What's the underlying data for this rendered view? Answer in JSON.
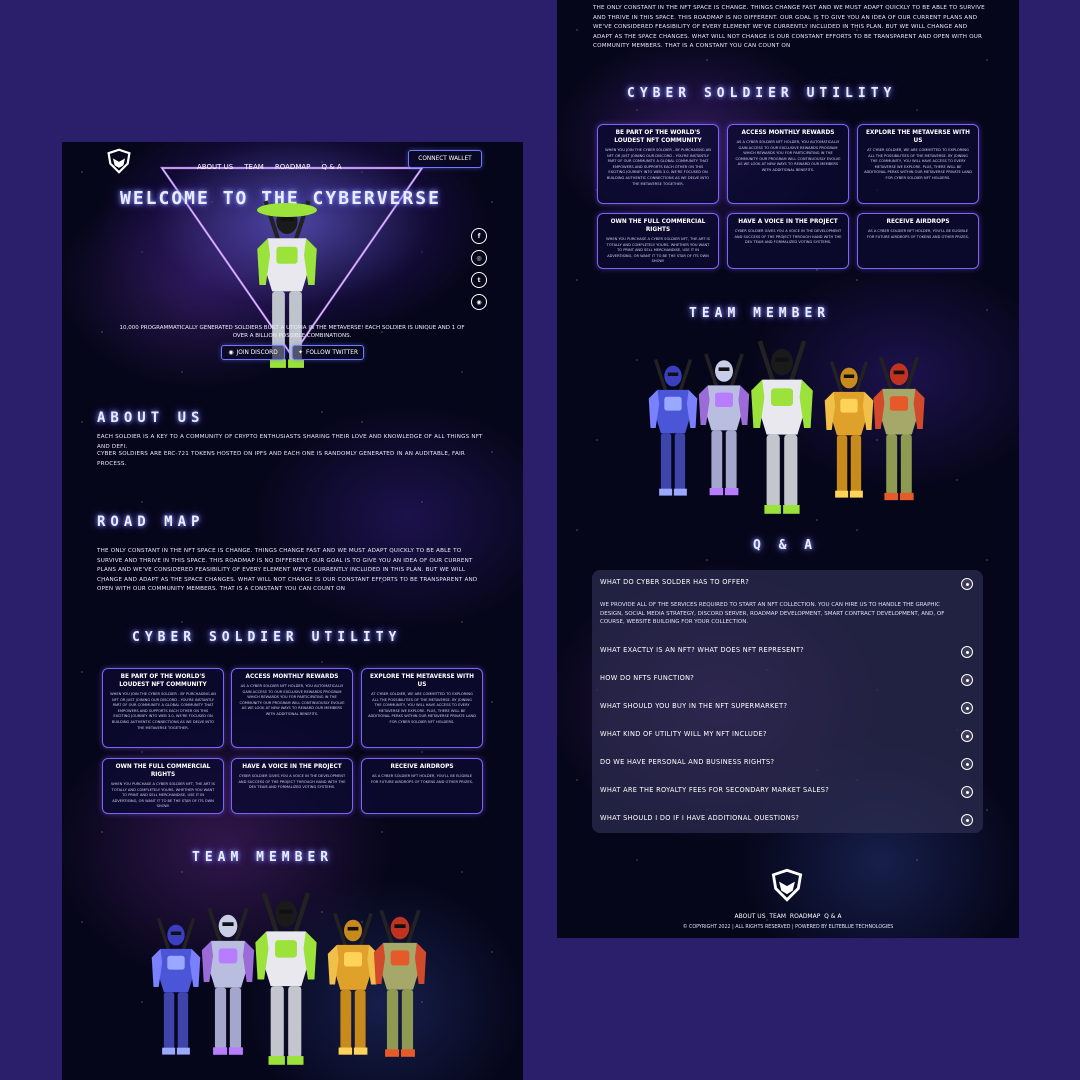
{
  "nav": {
    "items": [
      "ABOUT US",
      "TEAM",
      "ROADMAP",
      "Q & A"
    ],
    "connect_wallet": "CONNECT WALLET"
  },
  "hero": {
    "title": "WELCOME TO THE CYBERVERSE",
    "tagline": "10,000 PROGRAMMATICALLY GENERATED SOLDIERS BUILT A UTOPIA IN THE METAVERSE! EACH SOLDIER IS UNIQUE AND 1 OF OVER A BILLION POSSIBLE COMBINATIONS.",
    "join_discord": "JOIN DISCORD",
    "follow_twitter": "FOLLOW TWITTER"
  },
  "social": [
    {
      "name": "facebook-icon",
      "glyph": "f"
    },
    {
      "name": "instagram-icon",
      "glyph": "◎"
    },
    {
      "name": "twitter-icon",
      "glyph": "t"
    },
    {
      "name": "discord-icon",
      "glyph": "◉"
    }
  ],
  "about": {
    "heading": "ABOUT US",
    "text1": "EACH SOLDIER IS A KEY TO A COMMUNITY OF CRYPTO ENTHUSIASTS SHARING THEIR LOVE AND KNOWLEDGE OF ALL THINGS NFT AND DEFI.",
    "text2": "CYBER SOLDIERS ARE ERC-721 TOKENS HOSTED ON IPFS AND EACH ONE IS RANDOMLY GENERATED IN AN AUDITABLE, FAIR PROCESS."
  },
  "roadmap": {
    "heading": "ROAD MAP",
    "text": "THE ONLY CONSTANT IN THE NFT SPACE IS CHANGE. THINGS CHANGE FAST AND WE MUST ADAPT QUICKLY TO BE ABLE TO SURVIVE AND THRIVE IN THIS SPACE. THIS ROADMAP IS NO DIFFERENT. OUR GOAL IS TO GIVE YOU AN IDEA OF OUR CURRENT PLANS AND WE'VE CONSIDERED FEASIBILITY OF EVERY ELEMENT WE'VE CURRENTLY INCLUDED IN THIS PLAN. BUT WE WILL CHANGE AND ADAPT AS THE SPACE CHANGES. WHAT WILL NOT CHANGE IS OUR CONSTANT EFFORTS TO BE TRANSPARENT AND OPEN WITH OUR COMMUNITY MEMBERS. THAT IS A CONSTANT YOU CAN COUNT ON"
  },
  "utility": {
    "heading": "CYBER SOLDIER UTILITY",
    "cards": [
      {
        "title": "BE PART OF THE WORLD'S LOUDEST NFT COMMUNITY",
        "desc": "WHEN YOU JOIN THE CYBER SOLDIER - BY PURCHASING AN NFT OR JUST JOINING OUR DISCORD - YOU'RE INSTANTLY PART OF OUR COMMUNITY. A GLOBAL COMMUNITY THAT EMPOWERS AND SUPPORTS EACH OTHER ON THIS EXCITING JOURNEY INTO WEB 3.0. WE'RE FOCUSED ON BUILDING AUTHENTIC CONNECTIONS AS WE DELVE INTO THE METAVERSE TOGETHER."
      },
      {
        "title": "ACCESS MONTHLY REWARDS",
        "desc": "AS A CYBER SOLDIER NFT HOLDER, YOU AUTOMATICALLY GAIN ACCESS TO OUR EXCLUSIVE REWARDS PROGRAM WHICH REWARDS YOU FOR PARTICIPATING IN THE COMMUNITY. OUR PROGRAM WILL CONTINUOUSLY EVOLVE AS WE LOOK AT NEW WAYS TO REWARD OUR MEMBERS WITH ADDITIONAL BENEFITS."
      },
      {
        "title": "EXPLORE THE METAVERSE WITH US",
        "desc": "AT CYBER SOLDIER, WE ARE COMMITTED TO EXPLORING ALL THE POSSIBILITIES OF THE METAVERSE. BY JOINING THE COMMUNITY, YOU WILL HAVE ACCESS TO EVERY METAVERSE WE EXPLORE. PLUS, THERE WILL BE ADDITIONAL PERKS WITHIN OUR METAVERSE PRIVATE LAND FOR CYBER SOLDIER NFT HOLDERS."
      },
      {
        "title": "OWN THE FULL COMMERCIAL RIGHTS",
        "desc": "WHEN YOU PURCHASE A CYBER SOLDIER NFT, THE ART IS TOTALLY AND COMPLETELY YOURS. WHETHER YOU WANT TO PRINT AND SELL MERCHANDISE, USE IT IN ADVERTISING, OR WANT IT TO BE THE STAR OF ITS OWN SHOW!"
      },
      {
        "title": "HAVE A VOICE IN THE PROJECT",
        "desc": "CYBER SOLDIER GIVES YOU A VOICE IN THE DEVELOPMENT AND SUCCESS OF THE PROJECT THROUGH HAND WITH THE DEV TEAM AND FORMALIZED VOTING SYSTEMS."
      },
      {
        "title": "RECEIVE AIRDROPS",
        "desc": "AS A CYBER SOLDIER NFT HOLDER, YOU'LL BE ELIGIBLE FOR FUTURE AIRDROPS OF TOKENS AND OTHER PRIZES."
      }
    ]
  },
  "team": {
    "heading": "TEAM MEMBER"
  },
  "qa": {
    "heading": "Q & A",
    "items": [
      {
        "q": "WHAT DO CYBER SOLDER HAS TO OFFER?",
        "a": "WE PROVIDE ALL OF THE SERVICES REQUIRED TO START AN NFT COLLECTION. YOU CAN HIRE US TO HANDLE THE GRAPHIC DESIGN, SOCIAL MEDIA STRATEGY, DISCORD SERVER, ROADMAP DEVELOPMENT, SMART CONTRACT DEVELOPMENT, AND, OF COURSE, WEBSITE BUILDING FOR YOUR COLLECTION."
      },
      {
        "q": "WHAT EXACTLY IS AN NFT? WHAT DOES NFT REPRESENT?"
      },
      {
        "q": "HOW DO NFTS FUNCTION?"
      },
      {
        "q": "WHAT SHOULD YOU BUY IN THE NFT SUPERMARKET?"
      },
      {
        "q": "WHAT KIND OF UTILITY WILL MY NFT INCLUDE?"
      },
      {
        "q": "DO WE HAVE PERSONAL AND BUSINESS RIGHTS?"
      },
      {
        "q": "WHAT ARE THE ROYALTY FEES FOR SECONDARY MARKET SALES?"
      },
      {
        "q": "WHAT SHOULD I DO IF I HAVE ADDITIONAL QUESTIONS?"
      }
    ]
  },
  "footer": {
    "nav": [
      "ABOUT US",
      "TEAM",
      "ROADMAP",
      "Q & A"
    ],
    "copyright": "© COPYRIGHT 2022 | ALL RIGHTS RESERVED | POWERED BY ELITEBLUE TECHNOLOGIES"
  },
  "colors": {
    "page_bg": "#2b1f6b",
    "panel_bg": "#06061a",
    "accent_purple": "#7a66ff",
    "soldier_green": "#9be23a"
  }
}
